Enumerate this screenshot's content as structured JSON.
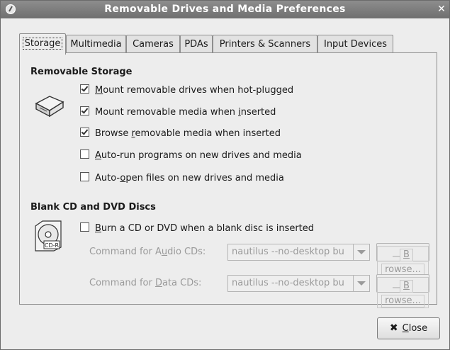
{
  "window": {
    "title": "Removable Drives and Media Preferences"
  },
  "tabs": [
    {
      "label": "Storage",
      "active": true
    },
    {
      "label": "Multimedia",
      "active": false
    },
    {
      "label": "Cameras",
      "active": false
    },
    {
      "label": "PDAs",
      "active": false
    },
    {
      "label": "Printers & Scanners",
      "active": false
    },
    {
      "label": "Input Devices",
      "active": false
    }
  ],
  "removable_storage": {
    "title": "Removable Storage",
    "icon": "drive-icon",
    "options": [
      {
        "pre": "",
        "mnemonic": "M",
        "post": "ount removable drives when hot-plugged",
        "checked": true
      },
      {
        "pre": "Mount removable media when ",
        "mnemonic": "i",
        "post": "nserted",
        "checked": true
      },
      {
        "pre": "Browse ",
        "mnemonic": "r",
        "post": "emovable media when inserted",
        "checked": true
      },
      {
        "pre": "",
        "mnemonic": "A",
        "post": "uto-run programs on new drives and media",
        "checked": false
      },
      {
        "pre": "Auto-",
        "mnemonic": "o",
        "post": "pen files on new drives and media",
        "checked": false
      }
    ]
  },
  "blank_discs": {
    "title": "Blank CD and DVD Discs",
    "icon": "cd-r-icon",
    "icon_label": "CD-R",
    "burn_option": {
      "pre": "",
      "mnemonic": "B",
      "post": "urn a CD or DVD when a blank disc is inserted",
      "checked": false
    },
    "audio": {
      "pre": "Command for A",
      "mnemonic": "u",
      "post": "dio CDs:",
      "value": "nautilus --no-desktop bu",
      "browse_pre": "",
      "browse_mnemonic": "B",
      "browse_post": "rowse..."
    },
    "data": {
      "pre": "Command for ",
      "mnemonic": "D",
      "post": "ata CDs:",
      "value": "nautilus --no-desktop bu",
      "browse_pre": "",
      "browse_mnemonic": "B",
      "browse_post": "rowse..."
    }
  },
  "close_button": {
    "pre": "",
    "mnemonic": "C",
    "post": "lose"
  }
}
